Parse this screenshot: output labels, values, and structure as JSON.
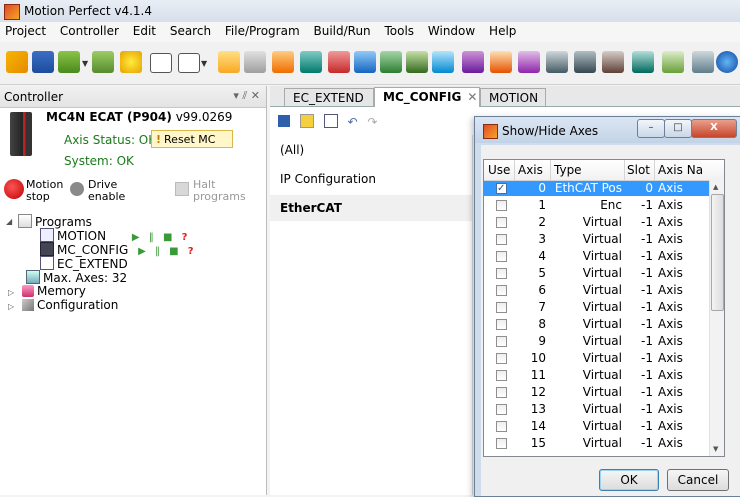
{
  "app": {
    "title": "Motion Perfect v4.1.4"
  },
  "menu": [
    "Project",
    "Controller",
    "Edit",
    "Search",
    "File/Program",
    "Build/Run",
    "Tools",
    "Window",
    "Help"
  ],
  "controller_panel": {
    "title": "Controller",
    "pin_controls": "▾ ⫽ ✕",
    "controller_name": "MC4N ECAT (P904)",
    "version": "v99.0269",
    "axis_status": "Axis Status: OK",
    "reset_label": "Reset MC",
    "system_status": "System: OK",
    "motion_stop": [
      "Motion",
      "stop"
    ],
    "drive_enable": [
      "Drive",
      "enable"
    ],
    "halt_programs": [
      "Halt",
      "programs"
    ],
    "tree": {
      "programs_label": "Programs",
      "programs": [
        {
          "name": "MOTION",
          "has_controls": true
        },
        {
          "name": "MC_CONFIG",
          "has_controls": true
        },
        {
          "name": "EC_EXTEND",
          "has_controls": false
        }
      ],
      "control_glyphs": "▶ ‖ ■",
      "control_q": "?",
      "max_axes": "Max. Axes: 32",
      "memory": "Memory",
      "configuration": "Configuration"
    }
  },
  "tabs": [
    {
      "label": "EC_EXTEND",
      "active": false
    },
    {
      "label": "MC_CONFIG",
      "active": true
    },
    {
      "label": "MOTION",
      "active": false
    }
  ],
  "config_list": [
    "(All)",
    "IP Configuration",
    "EtherCAT"
  ],
  "config_selected": "EtherCAT",
  "dialog": {
    "title": "Show/Hide Axes",
    "columns": [
      "Use",
      "Axis",
      "Type",
      "Slot",
      "Axis Na"
    ],
    "rows": [
      {
        "use": true,
        "axis": "0",
        "type": "EthCAT Pos",
        "slot": "0",
        "name": "Axis",
        "selected": true
      },
      {
        "use": false,
        "axis": "1",
        "type": "Enc",
        "slot": "-1",
        "name": "Axis"
      },
      {
        "use": false,
        "axis": "2",
        "type": "Virtual",
        "slot": "-1",
        "name": "Axis"
      },
      {
        "use": false,
        "axis": "3",
        "type": "Virtual",
        "slot": "-1",
        "name": "Axis"
      },
      {
        "use": false,
        "axis": "4",
        "type": "Virtual",
        "slot": "-1",
        "name": "Axis"
      },
      {
        "use": false,
        "axis": "5",
        "type": "Virtual",
        "slot": "-1",
        "name": "Axis"
      },
      {
        "use": false,
        "axis": "6",
        "type": "Virtual",
        "slot": "-1",
        "name": "Axis"
      },
      {
        "use": false,
        "axis": "7",
        "type": "Virtual",
        "slot": "-1",
        "name": "Axis"
      },
      {
        "use": false,
        "axis": "8",
        "type": "Virtual",
        "slot": "-1",
        "name": "Axis"
      },
      {
        "use": false,
        "axis": "9",
        "type": "Virtual",
        "slot": "-1",
        "name": "Axis"
      },
      {
        "use": false,
        "axis": "10",
        "type": "Virtual",
        "slot": "-1",
        "name": "Axis"
      },
      {
        "use": false,
        "axis": "11",
        "type": "Virtual",
        "slot": "-1",
        "name": "Axis"
      },
      {
        "use": false,
        "axis": "12",
        "type": "Virtual",
        "slot": "-1",
        "name": "Axis"
      },
      {
        "use": false,
        "axis": "13",
        "type": "Virtual",
        "slot": "-1",
        "name": "Axis"
      },
      {
        "use": false,
        "axis": "14",
        "type": "Virtual",
        "slot": "-1",
        "name": "Axis"
      },
      {
        "use": false,
        "axis": "15",
        "type": "Virtual",
        "slot": "-1",
        "name": "Axis"
      }
    ],
    "ok_label": "OK",
    "cancel_label": "Cancel",
    "window_buttons": [
      "–",
      "□",
      "X"
    ]
  },
  "colors": {
    "status_ok": "#1a7a1a",
    "selection": "#3399ff",
    "tab_border": "#9aa"
  }
}
